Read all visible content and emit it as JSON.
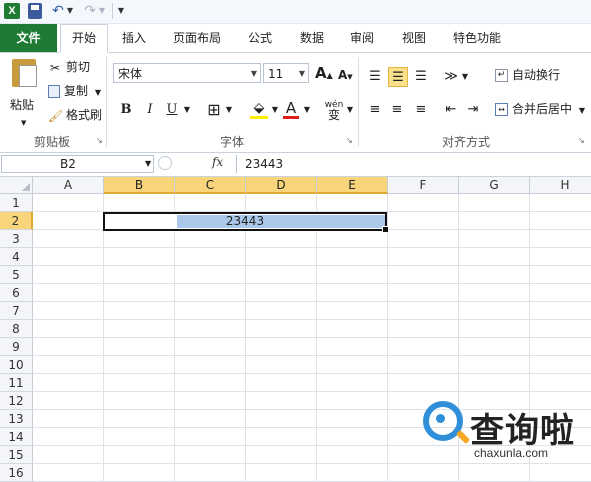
{
  "quick_access": {
    "logo": "X",
    "icons": [
      "excel-logo-icon",
      "save-icon",
      "undo-icon",
      "redo-icon",
      "customize-icon"
    ]
  },
  "tabs": [
    {
      "label": "文件",
      "active": false
    },
    {
      "label": "开始",
      "active": true
    },
    {
      "label": "插入",
      "active": false
    },
    {
      "label": "页面布局",
      "active": false
    },
    {
      "label": "公式",
      "active": false
    },
    {
      "label": "数据",
      "active": false
    },
    {
      "label": "审阅",
      "active": false
    },
    {
      "label": "视图",
      "active": false
    },
    {
      "label": "特色功能",
      "active": false
    }
  ],
  "ribbon": {
    "clipboard": {
      "group_label": "剪贴板",
      "paste": "粘贴",
      "cut": "剪切",
      "copy": "复制",
      "format_painter": "格式刷"
    },
    "font": {
      "group_label": "字体",
      "font_name": "宋体",
      "font_size": "11",
      "grow": "A",
      "shrink": "A",
      "bold": "B",
      "italic": "I",
      "underline": "U",
      "wen": "wén",
      "wen_char": "变"
    },
    "alignment": {
      "group_label": "对齐方式",
      "wrap_text": "自动换行",
      "merge_center": "合并后居中"
    }
  },
  "formula_bar": {
    "name_box": "B2",
    "fx": "fx",
    "value": "23443"
  },
  "grid": {
    "columns": [
      "A",
      "B",
      "C",
      "D",
      "E",
      "F",
      "G",
      "H"
    ],
    "rows": [
      "1",
      "2",
      "3",
      "4",
      "5",
      "6",
      "7",
      "8",
      "9",
      "10",
      "11",
      "12",
      "13",
      "14",
      "15",
      "16"
    ],
    "selected_columns": [
      "B",
      "C",
      "D",
      "E"
    ],
    "selected_row": "2",
    "cell_b2": "23443"
  },
  "watermark": {
    "brand": "查询啦",
    "url": "chaxunla.com"
  },
  "colors": {
    "file_tab": "#1f7a33",
    "selected_header": "#f8d57a",
    "selection_fill": "#a9c8ea",
    "watermark_blue": "#2f8fd8"
  }
}
